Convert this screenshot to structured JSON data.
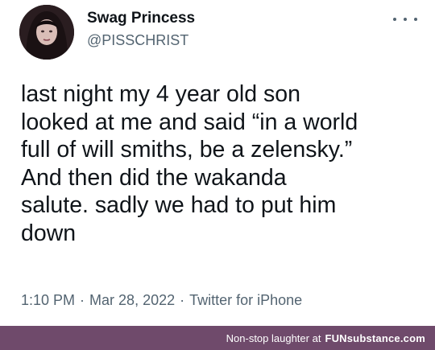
{
  "tweet": {
    "display_name": "Swag Princess",
    "handle": "@PISSCHRIST",
    "text": "last night my 4 year old son\nlooked at me and said “in a world\nfull of will smiths, be a zelensky.”\nAnd then did the wakanda\nsalute. sadly we had to put him\ndown",
    "time": "1:10 PM",
    "date": "Mar 28, 2022",
    "source": "Twitter for iPhone",
    "separator": "·"
  },
  "icons": {
    "avatar": "profile-avatar",
    "more": "more-horizontal-icon"
  },
  "footer": {
    "tagline": "Non-stop laughter at",
    "brand": "FUNsubstance.com"
  },
  "colors": {
    "text": "#0f1419",
    "secondary": "#536471",
    "footer_bg": "#6f4a6b"
  }
}
